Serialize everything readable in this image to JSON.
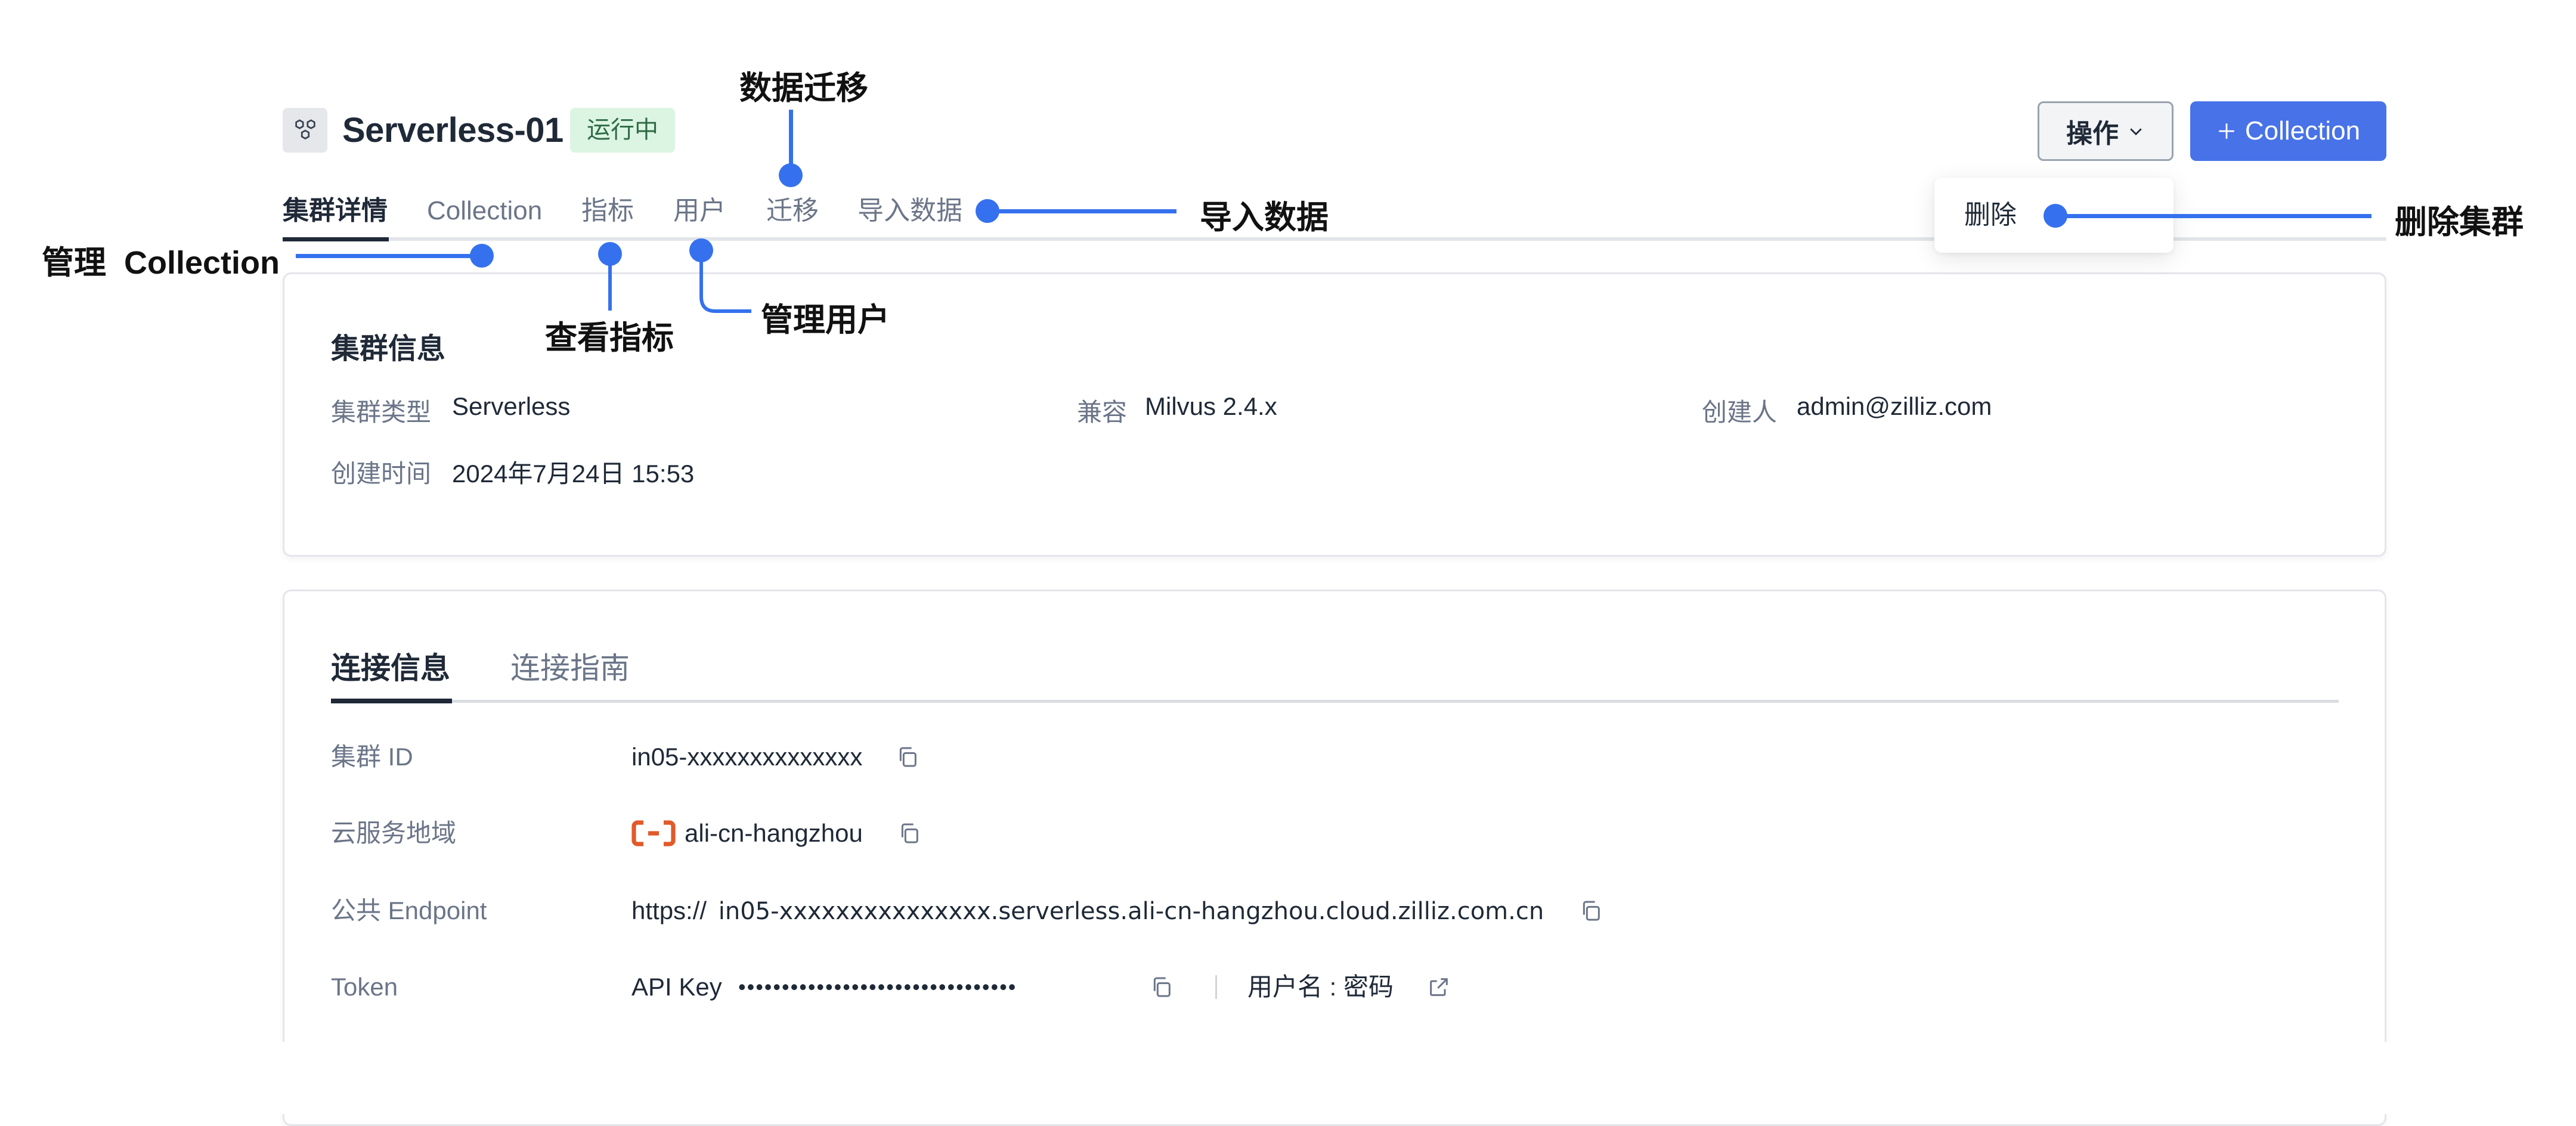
{
  "header": {
    "icon": "cluster-hexagons-icon",
    "title": "Serverless-01",
    "status": "运行中",
    "ops_button": "操作",
    "ops_chevron": "chevron-down-icon",
    "add_button": "Collection",
    "add_icon": "plus-icon"
  },
  "tabs": [
    {
      "label": "集群详情",
      "active": true
    },
    {
      "label": "Collection",
      "active": false
    },
    {
      "label": "指标",
      "active": false
    },
    {
      "label": "用户",
      "active": false
    },
    {
      "label": "迁移",
      "active": false
    },
    {
      "label": "导入数据",
      "active": false
    }
  ],
  "dropdown": {
    "items": [
      {
        "label": "删除"
      }
    ]
  },
  "cluster_info": {
    "title": "集群信息",
    "fields": [
      {
        "label": "集群类型",
        "value": "Serverless"
      },
      {
        "label": "兼容",
        "value": "Milvus 2.4.x"
      },
      {
        "label": "创建人",
        "value": "admin@zilliz.com"
      },
      {
        "label": "创建时间",
        "value": "2024年7月24日 15:53"
      }
    ]
  },
  "connection": {
    "tabs": [
      {
        "label": "连接信息",
        "active": true
      },
      {
        "label": "连接指南",
        "active": false
      }
    ],
    "rows": [
      {
        "label": "集群 ID",
        "value": "in05-xxxxxxxxxxxxxx"
      },
      {
        "label": "云服务地域",
        "value": "ali-cn-hangzhou",
        "provider_icon": "alibaba-cloud-icon",
        "provider_color": "#e2592a"
      },
      {
        "label": "公共 Endpoint",
        "prefix": "https://",
        "value": "in05-xxxxxxxxxxxxxxx.serverless.ali-cn-hangzhou.cloud.zilliz.com.cn"
      },
      {
        "label": "Token",
        "key_label": "API Key",
        "key_value": "••••••••••••••••••••••••••••••••",
        "alt_label": "用户名 : 密码"
      }
    ]
  },
  "annotations": {
    "data_migration": "数据迁移",
    "import_data": "导入数据",
    "delete_cluster": "删除集群",
    "manage_collection": "管理  Collection",
    "view_metrics": "查看指标",
    "manage_users": "管理用户"
  },
  "colors": {
    "primary": "#4772e8",
    "annotation": "#3571ee",
    "status_bg": "#dcf5e3",
    "status_text": "#2f6b46",
    "text": "#1f2937",
    "muted": "#6b7588"
  }
}
